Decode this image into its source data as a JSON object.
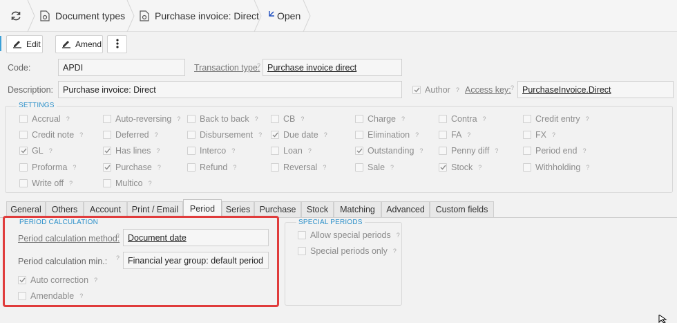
{
  "breadcrumb": {
    "refresh_icon": "refresh-icon",
    "items": [
      {
        "label": "Document types",
        "icon": "doc-gear-icon"
      },
      {
        "label": "Purchase invoice: Direct",
        "icon": "doc-gear-icon"
      },
      {
        "label": "Open",
        "icon": "open-arrow-icon"
      }
    ]
  },
  "toolbar": {
    "edit_label": "Edit",
    "amend_label": "Amend",
    "more_icon": "more-vertical-icon"
  },
  "form": {
    "code_label": "Code:",
    "code_value": "APDI",
    "transaction_type_label": "Transaction type:",
    "transaction_type_value": "Purchase invoice direct",
    "description_label": "Description:",
    "description_value": "Purchase invoice: Direct",
    "author_label": "Author",
    "author_checked": true,
    "access_key_label": "Access key:",
    "access_key_value": "PurchaseInvoice.Direct"
  },
  "settings": {
    "title": "SETTINGS",
    "help_mark": "?",
    "rows": [
      [
        {
          "label": "Accrual",
          "checked": false,
          "help": true
        },
        {
          "label": "Auto-reversing",
          "checked": false,
          "help": true
        },
        {
          "label": "Back to back",
          "checked": false,
          "help": true
        },
        {
          "label": "CB",
          "checked": false,
          "help": true
        },
        {
          "label": "Charge",
          "checked": false,
          "help": true
        },
        {
          "label": "Contra",
          "checked": false,
          "help": true
        },
        {
          "label": "Credit entry",
          "checked": false,
          "help": true
        }
      ],
      [
        {
          "label": "Credit note",
          "checked": false,
          "help": true
        },
        {
          "label": "Deferred",
          "checked": false,
          "help": true
        },
        {
          "label": "Disbursement",
          "checked": false,
          "help": true
        },
        {
          "label": "Due date",
          "checked": true,
          "help": true
        },
        {
          "label": "Elimination",
          "checked": false,
          "help": true
        },
        {
          "label": "FA",
          "checked": false,
          "help": true
        },
        {
          "label": "FX",
          "checked": false,
          "help": true
        }
      ],
      [
        {
          "label": "GL",
          "checked": true,
          "help": true
        },
        {
          "label": "Has lines",
          "checked": true,
          "help": true
        },
        {
          "label": "Interco",
          "checked": false,
          "help": true
        },
        {
          "label": "Loan",
          "checked": false,
          "help": true
        },
        {
          "label": "Outstanding",
          "checked": true,
          "help": true
        },
        {
          "label": "Penny diff",
          "checked": false,
          "help": true
        },
        {
          "label": "Period end",
          "checked": false,
          "help": true
        }
      ],
      [
        {
          "label": "Proforma",
          "checked": false,
          "help": true
        },
        {
          "label": "Purchase",
          "checked": true,
          "help": true
        },
        {
          "label": "Refund",
          "checked": false,
          "help": true
        },
        {
          "label": "Reversal",
          "checked": false,
          "help": true
        },
        {
          "label": "Sale",
          "checked": false,
          "help": true
        },
        {
          "label": "Stock",
          "checked": true,
          "help": true
        },
        {
          "label": "Withholding",
          "checked": false,
          "help": true
        }
      ],
      [
        {
          "label": "Write off",
          "checked": false,
          "help": true
        },
        {
          "label": "Multico",
          "checked": false,
          "help": true
        }
      ]
    ]
  },
  "tabs": [
    {
      "label": "General",
      "active": false
    },
    {
      "label": "Others",
      "active": false
    },
    {
      "label": "Account",
      "active": false
    },
    {
      "label": "Print / Email",
      "active": false
    },
    {
      "label": "Period",
      "active": true
    },
    {
      "label": "Series",
      "active": false
    },
    {
      "label": "Purchase",
      "active": false
    },
    {
      "label": "Stock",
      "active": false
    },
    {
      "label": "Matching",
      "active": false
    },
    {
      "label": "Advanced",
      "active": false
    },
    {
      "label": "Custom fields",
      "active": false
    }
  ],
  "period_calc": {
    "title": "PERIOD CALCULATION",
    "method_label": "Period calculation method:",
    "method_value": "Document date",
    "min_label": "Period calculation min.:",
    "min_value": "Financial year group: default period",
    "auto_correction": {
      "label": "Auto correction",
      "checked": true
    },
    "amendable": {
      "label": "Amendable",
      "checked": false
    }
  },
  "special_periods": {
    "title": "SPECIAL PERIODS",
    "allow": {
      "label": "Allow special periods",
      "checked": false
    },
    "only": {
      "label": "Special periods only",
      "checked": false
    }
  },
  "highlight_color": "#e03c3c",
  "accent_color": "#2a8fc9"
}
